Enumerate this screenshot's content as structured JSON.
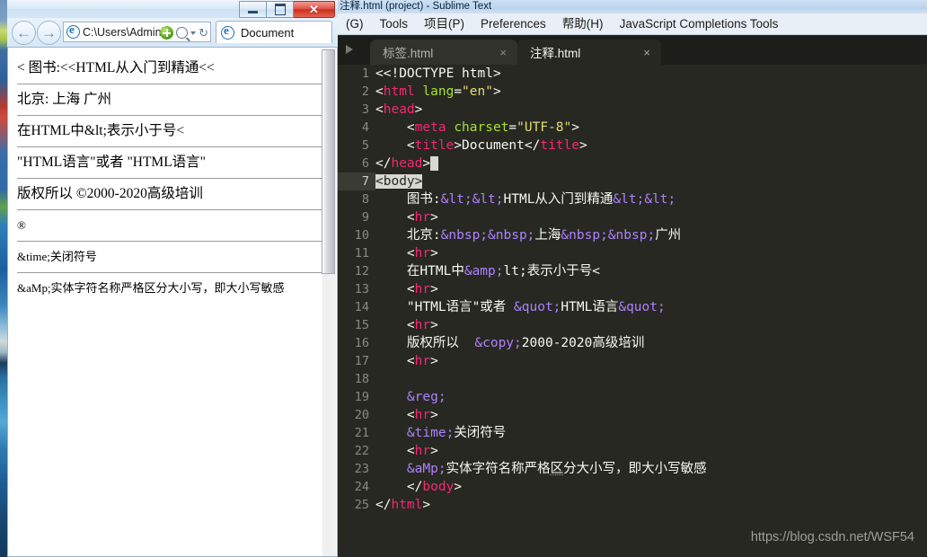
{
  "browser": {
    "window_controls": {
      "minimize": "—",
      "maximize": "□",
      "close": "✕"
    },
    "address_value": "C:\\Users\\Admini",
    "tab_title": "Document",
    "document_lines": [
      "< 图书:<<HTML从入门到精通<<",
      "北京:  上海  广州",
      "在HTML中&lt;表示小于号<",
      "\"HTML语言\"或者 \"HTML语言\"",
      "版权所以   ©2000-2020高级培训",
      "®",
      "&time;关闭符号",
      "&aMp;实体字符名称严格区分大小写，即大小写敏感"
    ]
  },
  "sublime": {
    "title": "注释.html (project) - Sublime Text",
    "menu": [
      "(G)",
      "Tools",
      "项目(P)",
      "Preferences",
      "帮助(H)",
      "JavaScript Completions Tools"
    ],
    "tabs": [
      {
        "label": "标签.html",
        "close": "×",
        "active": false
      },
      {
        "label": "注释.html",
        "close": "×",
        "active": true
      }
    ],
    "line_numbers": [
      "1",
      "2",
      "3",
      "4",
      "5",
      "6",
      "7",
      "8",
      "9",
      "10",
      "11",
      "12",
      "13",
      "14",
      "15",
      "16",
      "17",
      "18",
      "19",
      "20",
      "21",
      "22",
      "23",
      "24",
      "25"
    ],
    "code_lines": [
      "<<!DOCTYPE html>",
      "<html lang=\"en\">",
      "<head>",
      "    <meta charset=\"UTF-8\">",
      "    <title>Document</title>",
      "</head>",
      "<body>",
      "    图书:&lt;&lt;HTML从入门到精通&lt;&lt;",
      "    <hr>",
      "    北京:&nbsp;&nbsp;上海&nbsp;&nbsp;广州",
      "    <hr>",
      "    在HTML中&amp;lt;表示小于号<",
      "    <hr>",
      "    \"HTML语言\"或者 &quot;HTML语言&quot;",
      "    <hr>",
      "    版权所以  &copy;2000-2020高级培训",
      "    <hr>",
      "",
      "    &reg;",
      "    <hr>",
      "    &time;关闭符号",
      "    <hr>",
      "    &aMp;实体字符名称严格区分大小写，即大小写敏感",
      "    </body>",
      "</html>"
    ],
    "active_line": 7,
    "watermark": "https://blog.csdn.net/WSF54"
  },
  "colors": {
    "editor_bg": "#272822",
    "tag": "#f92672",
    "attribute": "#a6e22e",
    "string": "#e6db74",
    "entity": "#ae81ff",
    "text": "#f8f8f2"
  }
}
